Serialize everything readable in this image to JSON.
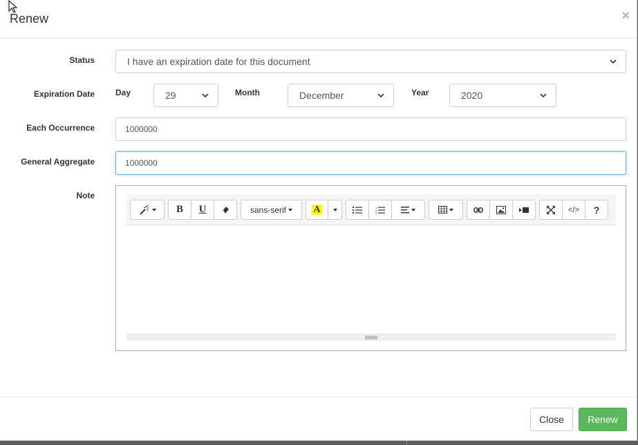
{
  "modal": {
    "title": "Renew",
    "close_glyph": "×"
  },
  "form": {
    "status": {
      "label": "Status",
      "value": "I have an expiration date for this document"
    },
    "expiration": {
      "label": "Expiration Date",
      "day_label": "Day",
      "day_value": "29",
      "month_label": "Month",
      "month_value": "December",
      "year_label": "Year",
      "year_value": "2020"
    },
    "each_occurrence": {
      "label": "Each Occurrence",
      "value": "1000000"
    },
    "general_aggregate": {
      "label": "General Aggregate",
      "value": "1000000"
    },
    "note": {
      "label": "Note"
    }
  },
  "editor": {
    "font_name": "sans-serif",
    "highlight_color": "#ffff00",
    "icons": [
      "magic-icon",
      "bold-icon",
      "underline-icon",
      "eraser-icon",
      "font-dropdown",
      "highlight-icon",
      "unordered-list-icon",
      "ordered-list-icon",
      "align-icon",
      "table-icon",
      "link-icon",
      "image-icon",
      "video-icon",
      "fullscreen-icon",
      "code-view-icon",
      "help-icon"
    ],
    "bold_glyph": "B",
    "underline_glyph": "U",
    "code_glyph": "</>",
    "help_glyph": "?",
    "highlight_glyph": "A"
  },
  "footer": {
    "close_label": "Close",
    "renew_label": "Renew"
  },
  "colors": {
    "primary_green": "#5cb85c",
    "focus_blue": "#66afe9"
  }
}
